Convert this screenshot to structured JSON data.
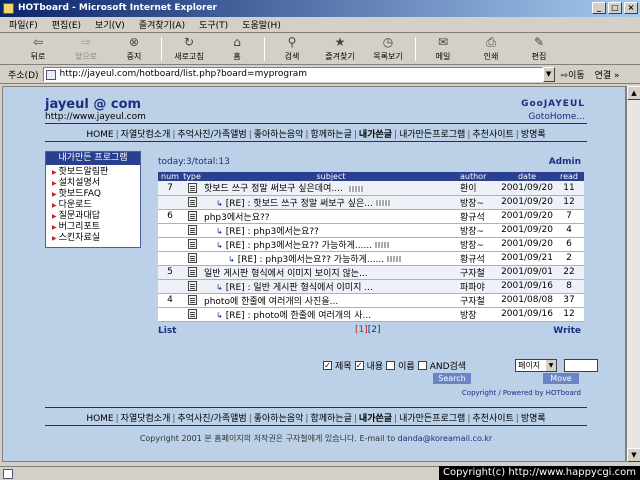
{
  "window": {
    "title": "HOTboard - Microsoft Internet Explorer",
    "buttons": [
      "_",
      "□",
      "×"
    ]
  },
  "menu": [
    "파일(F)",
    "편집(E)",
    "보기(V)",
    "즐겨찾기(A)",
    "도구(T)",
    "도움말(H)"
  ],
  "toolbar": [
    {
      "label": "뒤로",
      "icon": "back-arrow-icon",
      "glyph": "⇦",
      "enabled": true
    },
    {
      "label": "앞으로",
      "icon": "forward-arrow-icon",
      "glyph": "⇨",
      "enabled": false
    },
    {
      "label": "중지",
      "icon": "stop-icon",
      "glyph": "⊗",
      "enabled": true
    },
    {
      "label": "새로고침",
      "icon": "refresh-icon",
      "glyph": "↻",
      "enabled": true
    },
    {
      "label": "홈",
      "icon": "home-icon",
      "glyph": "⌂",
      "enabled": true
    },
    {
      "label": "검색",
      "icon": "search-icon",
      "glyph": "⚲",
      "enabled": true
    },
    {
      "label": "즐겨찾기",
      "icon": "favorites-icon",
      "glyph": "★",
      "enabled": true
    },
    {
      "label": "목록보기",
      "icon": "history-icon",
      "glyph": "◷",
      "enabled": true
    },
    {
      "label": "메일",
      "icon": "mail-icon",
      "glyph": "✉",
      "enabled": true
    },
    {
      "label": "인쇄",
      "icon": "print-icon",
      "glyph": "⎙",
      "enabled": true
    },
    {
      "label": "편집",
      "icon": "edit-icon",
      "glyph": "✎",
      "enabled": true
    }
  ],
  "address": {
    "label": "주소(D)",
    "url": "http://jayeul.com/hotboard/list.php?board=myprogram",
    "go": "이동",
    "links": "연결 »"
  },
  "site": {
    "title": "jayeul @ com",
    "url": "http://www.jayeul.com",
    "brand": "GooJAYEUL",
    "gotohome": "GotoHome...",
    "nav": [
      "HOME",
      "자열닷컴소개",
      "추억사진/가족앨범",
      "좋아하는음악",
      "함께하는글",
      "내가쓴글",
      "내가만든프로그램",
      "추천사이트",
      "방명록"
    ],
    "nav_bold_index": 5
  },
  "sidebar": {
    "title": "내가만든 프로그램",
    "items": [
      "핫보드알림판",
      "설치설명서",
      "핫보드FAQ",
      "다운로드",
      "질문과대답",
      "버그리포트",
      "스킨자료실"
    ]
  },
  "board": {
    "stats": "today:3/total:13",
    "admin": "Admin",
    "columns": [
      "num",
      "type",
      "subject",
      "author",
      "date",
      "read"
    ],
    "rows": [
      {
        "num": "7",
        "depth": 0,
        "subject": "핫보드 쓰구 정말 써보구 싶은데여.... ",
        "new": true,
        "author": "환이",
        "date": "2001/09/20",
        "read": "11"
      },
      {
        "num": "",
        "depth": 1,
        "subject": "[RE] : 핫보드 쓰구 정말 써보구 싶은...",
        "new": true,
        "author": "방장~",
        "date": "2001/09/20",
        "read": "12"
      },
      {
        "num": "6",
        "depth": 0,
        "subject": "php3에서는요??",
        "new": false,
        "author": "황규석",
        "date": "2001/09/20",
        "read": "7"
      },
      {
        "num": "",
        "depth": 1,
        "subject": "[RE] : php3에서는요??",
        "new": false,
        "author": "방장~",
        "date": "2001/09/20",
        "read": "4"
      },
      {
        "num": "",
        "depth": 1,
        "subject": "[RE] : php3에서는요?? 가능하게......",
        "new": true,
        "author": "방장~",
        "date": "2001/09/20",
        "read": "6"
      },
      {
        "num": "",
        "depth": 2,
        "subject": "[RE] : php3에서는요?? 가능하게......",
        "new": true,
        "author": "황규석",
        "date": "2001/09/21",
        "read": "2"
      },
      {
        "num": "5",
        "depth": 0,
        "subject": "일반 게시판 형식에서 이미지 보이지 않는...",
        "new": false,
        "author": "구자철",
        "date": "2001/09/01",
        "read": "22"
      },
      {
        "num": "",
        "depth": 1,
        "subject": "[RE] : 일반 게시판 형식에서 이미지 ...",
        "new": false,
        "author": "파파야",
        "date": "2001/09/16",
        "read": "8"
      },
      {
        "num": "4",
        "depth": 0,
        "subject": "photo에 한줄에 여러개의 사진을...",
        "new": false,
        "author": "구자철",
        "date": "2001/08/08",
        "read": "37"
      },
      {
        "num": "",
        "depth": 1,
        "subject": "[RE] : photo에 한줄에 여러개의 사...",
        "new": false,
        "author": "방장",
        "date": "2001/09/16",
        "read": "12"
      }
    ],
    "list_label": "List",
    "write_label": "Write",
    "pages": [
      "[1]",
      "[2]"
    ]
  },
  "search": {
    "options": [
      {
        "label": "제목",
        "checked": true
      },
      {
        "label": "내용",
        "checked": true
      },
      {
        "label": "이름",
        "checked": false
      },
      {
        "label": "AND검색",
        "checked": false
      }
    ],
    "button": "Search",
    "page_select": "페이지",
    "move_button": "Move",
    "powered": "Copyright / Powered by HOTboard"
  },
  "footer": {
    "text": "Copyright 2001 본 홈페이지의 저작권은 구자철에게 있습니다. E-mail to ",
    "email": "danda@koreamail.co.kr"
  },
  "overlay": {
    "copyright": "Copyright(c) http://www.happycgi.com"
  }
}
